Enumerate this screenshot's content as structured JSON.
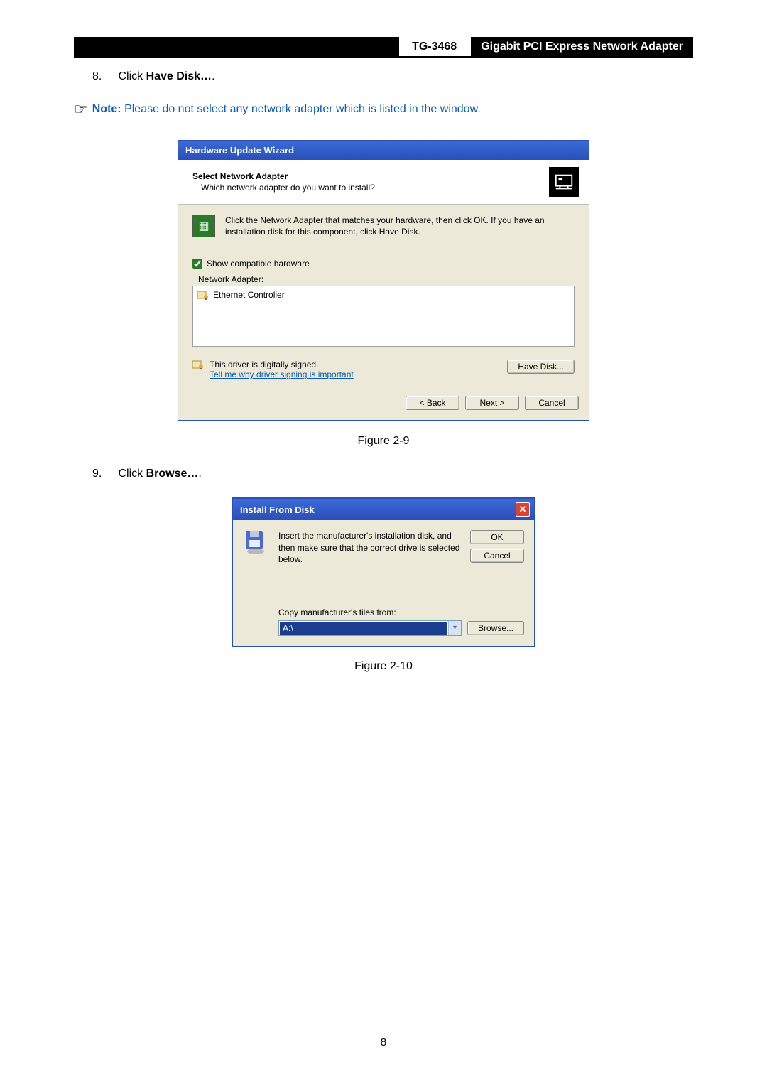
{
  "header": {
    "model": "TG-3468",
    "product": "Gigabit PCI Express Network Adapter"
  },
  "step8": {
    "num": "8.",
    "prefix": "Click ",
    "bold": "Have Disk…",
    "suffix": "."
  },
  "note": {
    "label": "Note:",
    "text": " Please do not select any network adapter which is listed in the window."
  },
  "wizard": {
    "title": "Hardware Update Wizard",
    "head_title": "Select Network Adapter",
    "head_sub": "Which network adapter do you want to install?",
    "instruction": "Click the Network Adapter that matches your hardware, then click OK. If you have an installation disk for this component, click Have Disk.",
    "show_compatible": "Show compatible hardware",
    "list_label": "Network Adapter:",
    "list_item": "Ethernet Controller",
    "signed_text": "This driver is digitally signed.",
    "signed_link": "Tell me why driver signing is important",
    "have_disk": "Have Disk...",
    "back": "< Back",
    "next": "Next >",
    "cancel": "Cancel"
  },
  "fig1": "Figure 2-9",
  "step9": {
    "num": "9.",
    "prefix": "Click ",
    "bold": "Browse…",
    "suffix": "."
  },
  "ifd": {
    "title": "Install From Disk",
    "instruction": "Insert the manufacturer's installation disk, and then make sure that the correct drive is selected below.",
    "ok": "OK",
    "cancel": "Cancel",
    "copy_label": "Copy manufacturer's files from:",
    "drive": "A:\\",
    "browse": "Browse..."
  },
  "fig2": "Figure 2-10",
  "page_number": "8"
}
